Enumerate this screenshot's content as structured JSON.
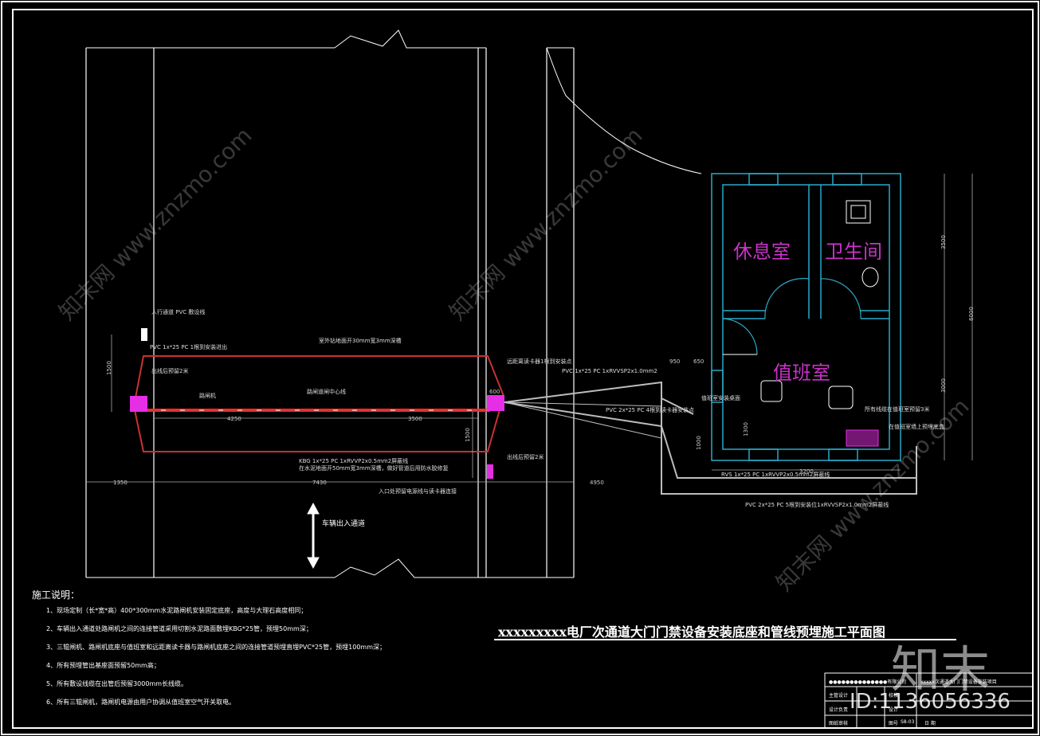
{
  "rooms": {
    "rest": "休息室",
    "toilet": "卫生间",
    "duty": "值班室"
  },
  "drawing_title": "xxxxxxxxx电厂次通道大门门禁设备安装底座和管线预埋施工平面图",
  "notes": {
    "heading": "施工说明：",
    "items": [
      "1、现场定制（长*宽*高）400*300mm水泥路闸机安装固定底座，高度与大理石高度相同；",
      "2、车辆出入通道处路闸机之间的连接管道采用切割水泥路面敷埋KBG*25管，预埋50mm深；",
      "3、三辊闸机、路闸机底座与值班室和远距离读卡器与路闸机底座之间的连接管道预埋直埋PVC*25管，预埋100mm深；",
      "4、所有预埋管出基座面预留50mm高；",
      "5、所有敷设线缆在出管后预留3000mm长线缆。",
      "6、所有三辊闸机，路闸机电源由用户协调从值班室空气开关取电。"
    ]
  },
  "direction_label": "车辆出入通道",
  "annotations": {
    "a1": "PVC 1x*25 PC 1根到安装进出",
    "a2": "人行通道 PVC 敷设线",
    "a3": "出线后预留2米",
    "a4": "路闸机",
    "a5": "路闸道闸中心线",
    "a6": "室外钻地面开30mm宽3mm深槽",
    "a7": "KBG 1x*25 PC 1xRVVP2x0.5mm2屏蔽线",
    "a8": "在水泥地面开50mm宽3mm深槽，做好管道后用防水胶修复",
    "a9": "入口处预留电源线与读卡器连接",
    "a10": "远距离读卡器1根到安装点",
    "a11": "PVC 1x*25 PC 1xRVVSP2x1.0mm2",
    "a12": "出线后预留2米",
    "a13": "PVC 2x*25 PC 4根到读卡器安装点",
    "a14": "所有线缆在值班室预留3米",
    "a15": "值班室安装桌面",
    "a16": "RVS 1x*25 PC 1xRVVP2x0.5mm2屏蔽线",
    "a17": "PVC 2x*25 PC 5根到安装位1xRVVSP2x1.0mm2屏蔽线",
    "a18": "在值班室墙上预埋底盒"
  },
  "dims": {
    "d1": "1500",
    "d2": "4250",
    "d3": "3500",
    "d4": "1500",
    "d5": "1350",
    "d6": "7430",
    "d7": "4950",
    "d8": "3200",
    "d9": "3500",
    "d10": "3000",
    "d11": "6000",
    "d12": "950",
    "d13": "650",
    "d14": "600",
    "d15": "1000",
    "d16": "1300"
  },
  "title_block": {
    "company": "●●●●●●●●●●●●●●有限公司",
    "project": "xxxxx次通道大门门禁设备安装项目",
    "r1": "主管设计",
    "r2": "设计负责",
    "r3": "图纸审核",
    "c1": "校核",
    "c2": "设计",
    "c3": "图号",
    "v3": "S8-03",
    "c4": "日 期"
  },
  "watermark": {
    "site": "知末网 www.znzmo.com",
    "brand": "知末",
    "id": "ID:1136056336"
  },
  "colors": {
    "background": "#000000",
    "room_walls": "#29a9c9",
    "room_label": "#c833c8",
    "gate_bar": "#e53030",
    "trench": "#c83232",
    "pipe": "#bdbdbd",
    "gate_post": "#e62ee6"
  }
}
